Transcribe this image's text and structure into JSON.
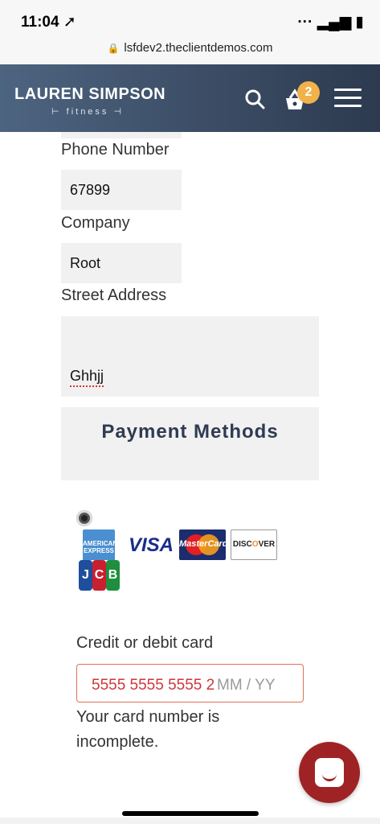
{
  "status_bar": {
    "time": "11:04 ➚",
    "icons": "···  ▂▄▆  ▮"
  },
  "browser": {
    "url": "lsfdev2.theclientdemos.com"
  },
  "header": {
    "logo_main": "LAUREN SIMPSON",
    "logo_sub": "⊢ fitness ⊣",
    "cart_count": "2"
  },
  "form": {
    "phone_label": "Phone Number",
    "phone_value": "67899",
    "company_label": "Company",
    "company_value": "Root",
    "street_label": "Street Address",
    "street_value": "Ghhjj"
  },
  "payment": {
    "section_title": "Payment Methods",
    "cards": {
      "amex": "AMERICAN EXPRESS",
      "visa": "VISA",
      "mastercard": "MasterCard",
      "discover_a": "DISC",
      "discover_o": "O",
      "discover_b": "VER",
      "jcb_j": "J",
      "jcb_c": "C",
      "jcb_b": "B"
    },
    "cc_label": "Credit or debit card",
    "cc_number": "5555 5555 5555 2",
    "cc_expiry_placeholder": "MM / YY",
    "cc_error": "Your card number is incomplete."
  },
  "colors": {
    "header_start": "#4d6480",
    "header_end": "#2d3a4f",
    "badge": "#f1b24a",
    "error_red": "#d0363a",
    "chat_red": "#9f2325"
  },
  "icons": [
    "location-arrow-icon",
    "lock-icon",
    "search-icon",
    "basket-icon",
    "hamburger-menu-icon",
    "chat-icon",
    "radio-selected-icon"
  ]
}
